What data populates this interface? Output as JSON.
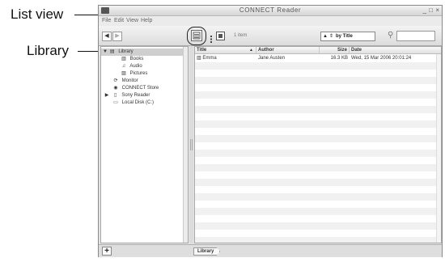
{
  "callouts": {
    "list_view": "List view",
    "library": "Library"
  },
  "window": {
    "title": "CONNECT Reader",
    "controls": [
      "_",
      "□",
      "×"
    ]
  },
  "menu": [
    "File",
    "Edit",
    "View",
    "Help"
  ],
  "toolbar": {
    "back": "◀",
    "forward": "▶",
    "item_count": "1 item",
    "sort_label": "by Title",
    "sort_arrow": "▲"
  },
  "sidebar": {
    "items": [
      {
        "label": "Library",
        "icon": "library-icon",
        "glyph": "▤",
        "arrow": "▼"
      },
      {
        "label": "Books",
        "icon": "book-icon",
        "glyph": "▥"
      },
      {
        "label": "Audio",
        "icon": "music-note-icon",
        "glyph": "♫"
      },
      {
        "label": "Pictures",
        "icon": "picture-icon",
        "glyph": "▨"
      },
      {
        "label": "Monitor",
        "icon": "sync-icon",
        "glyph": "⟳"
      },
      {
        "label": "CONNECT Store",
        "icon": "store-icon",
        "glyph": "◉"
      },
      {
        "label": "Sony Reader",
        "icon": "device-icon",
        "glyph": "▯",
        "arrow": "▶"
      },
      {
        "label": "Local Disk (C:)",
        "icon": "disk-icon",
        "glyph": "▭"
      }
    ]
  },
  "list": {
    "columns": [
      "Title",
      "Author",
      "Size",
      "Date"
    ],
    "rows": [
      {
        "title": "Emma",
        "author": "Jane Austen",
        "size": "16.3 KB",
        "date": "Wed, 15 Mar 2006 20:01:24"
      }
    ]
  },
  "status": {
    "add": "+",
    "breadcrumb": "Library"
  }
}
